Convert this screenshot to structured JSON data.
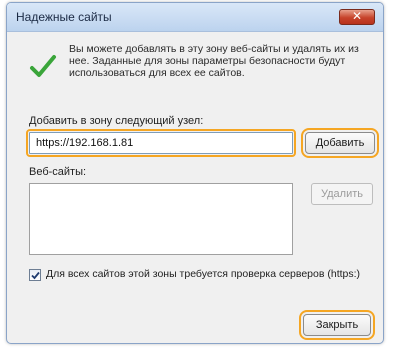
{
  "dialog": {
    "title": "Надежные сайты",
    "close_label": "✕",
    "info_text": "Вы можете добавлять в эту зону веб-сайты и удалять их из нее. Заданные для зоны параметры безопасности будут использоваться для всех ее сайтов.",
    "add_label": "Добавить в зону следующий узел:",
    "address_value": "https://192.168.1.81",
    "add_button": "Добавить",
    "sites_label": "Веб-сайты:",
    "remove_button": "Удалить",
    "sites": [],
    "require_https_label": "Для всех сайтов этой зоны требуется проверка серверов (https:)",
    "require_https_checked": true,
    "close_button": "Закрыть"
  },
  "colors": {
    "highlight": "#f5a623",
    "titlebar": "#bcd3ee",
    "checkmark": "#3aa53a",
    "close_button": "#c7432b"
  },
  "icons": {
    "info": "green-checkmark-icon",
    "close": "close-x-icon",
    "checkbox": "checkmark-icon"
  }
}
